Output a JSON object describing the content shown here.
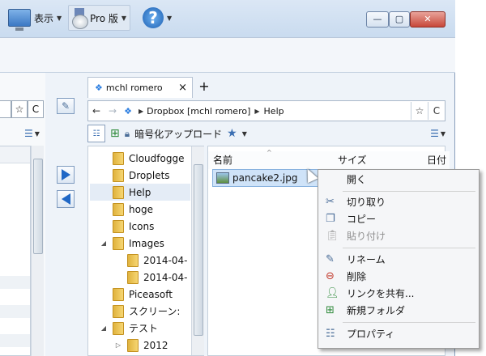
{
  "toolbar": {
    "view_label": "表示",
    "pro_label": "Pro 版",
    "help_glyph": "?"
  },
  "left_nav": {
    "star": "☆",
    "refresh": "C"
  },
  "tab": {
    "title": "mchl romero",
    "close": "×",
    "add": "+"
  },
  "address": {
    "back": "←",
    "forward": "→",
    "crumbs": [
      "Dropbox [mchl romero]",
      "Help"
    ],
    "crumb_sep": "▶",
    "star": "☆",
    "refresh": "C"
  },
  "toolbar2": {
    "encrypt_upload": "暗号化アップロード"
  },
  "tree": {
    "items": [
      "Cloudfogge",
      "Droplets",
      "Help",
      "hoge",
      "Icons",
      "Images",
      "2014-04-",
      "2014-04-",
      "Piceasoft",
      "スクリーン:",
      "テスト",
      "2012"
    ],
    "selected": "Help"
  },
  "list": {
    "columns": [
      "名前",
      "サイズ",
      "日付"
    ],
    "files": [
      {
        "name": "pancake2.jpg"
      }
    ]
  },
  "context_menu": {
    "open": "開く",
    "cut": "切り取り",
    "copy": "コピー",
    "paste": "貼り付け",
    "rename": "リネーム",
    "delete": "削除",
    "share_link": "リンクを共有...",
    "new_folder": "新規フォルダ",
    "properties": "プロパティ"
  },
  "colors": {
    "accent": "#1f67c6",
    "selection": "#cfe3f8",
    "folder": "#e8b84a"
  }
}
